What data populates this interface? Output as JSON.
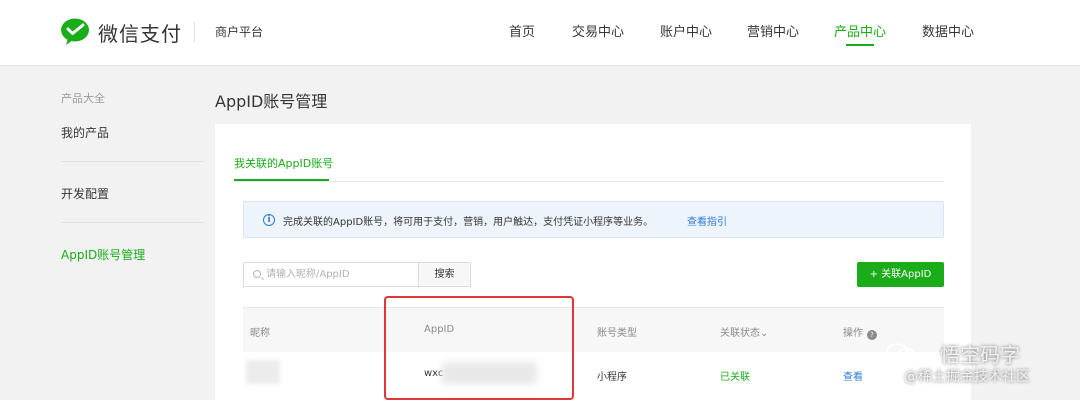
{
  "header": {
    "brand": "微信支付",
    "platform": "商户平台",
    "nav": [
      {
        "label": "首页",
        "active": false
      },
      {
        "label": "交易中心",
        "active": false
      },
      {
        "label": "账户中心",
        "active": false
      },
      {
        "label": "营销中心",
        "active": false
      },
      {
        "label": "产品中心",
        "active": true
      },
      {
        "label": "数据中心",
        "active": false
      }
    ]
  },
  "sidebar": {
    "title": "产品大全",
    "items": [
      {
        "label": "我的产品",
        "active": false
      },
      {
        "label": "开发配置",
        "active": false
      },
      {
        "label": "AppID账号管理",
        "active": true
      }
    ]
  },
  "main": {
    "title": "AppID账号管理",
    "tab": "我关联的AppID账号",
    "notice": {
      "icon": "info-icon",
      "text": "完成关联的AppID账号，将可用于支付，营销，用户触达，支付凭证小程序等业务。",
      "link": "查看指引"
    },
    "search": {
      "placeholder": "请输入昵称/AppID",
      "value": "",
      "button": "搜索"
    },
    "add_button": "+ 关联AppID",
    "table": {
      "headers": [
        "昵称",
        "AppID",
        "账号类型",
        "关联状态",
        "操作"
      ],
      "status_sort_icon": "chevron-down-icon",
      "help_icon": "?",
      "rows": [
        {
          "nickname": "",
          "appid": "wxc",
          "type": "小程序",
          "status": "已关联",
          "action": "查看"
        }
      ]
    }
  },
  "watermark": {
    "title": "悟空码字",
    "subtitle": "@稀土掘金技术社区"
  },
  "colors": {
    "accent": "#1aad19",
    "link": "#2f7bd6",
    "highlight": "#e23535"
  }
}
